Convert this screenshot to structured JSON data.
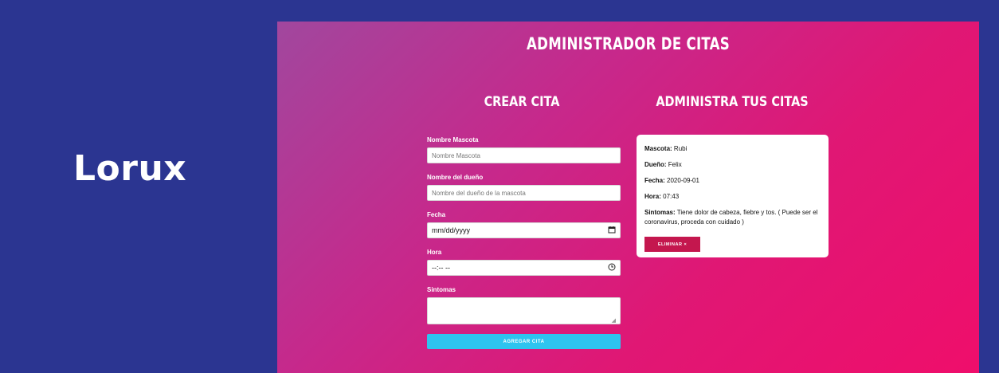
{
  "brand": "Lorux",
  "app": {
    "title": "ADMINISTRADOR DE CITAS",
    "create_title": "CREAR CITA",
    "admin_title": "ADMINISTRA TUS CITAS"
  },
  "form": {
    "pet_label": "Nombre Mascota",
    "pet_placeholder": "Nombre Mascota",
    "owner_label": "Nombre del dueño",
    "owner_placeholder": "Nombre del dueño de la mascota",
    "date_label": "Fecha",
    "date_value": "mm/dd/yyyy",
    "time_label": "Hora",
    "time_value": "--:-- --",
    "symptoms_label": "Sintomas",
    "submit_label": "AGREGAR CITA"
  },
  "appointment": {
    "pet_key": "Mascota:",
    "pet": "Rubi",
    "owner_key": "Dueño:",
    "owner": "Felix",
    "date_key": "Fecha:",
    "date": "2020-09-01",
    "time_key": "Hora:",
    "time": "07:43",
    "symptoms_key": "Sintomas:",
    "symptoms": "Tiene dolor de cabeza, fiebre y tos. ( Puede ser el coronavirus, proceda con cuidado )",
    "delete_label": "ELIMINAR ×"
  },
  "colors": {
    "background": "#2b3591",
    "submit": "#2ec4ef",
    "delete": "#c4174e"
  },
  "icons": {
    "date": "calendar-icon",
    "time": "clock-icon"
  }
}
